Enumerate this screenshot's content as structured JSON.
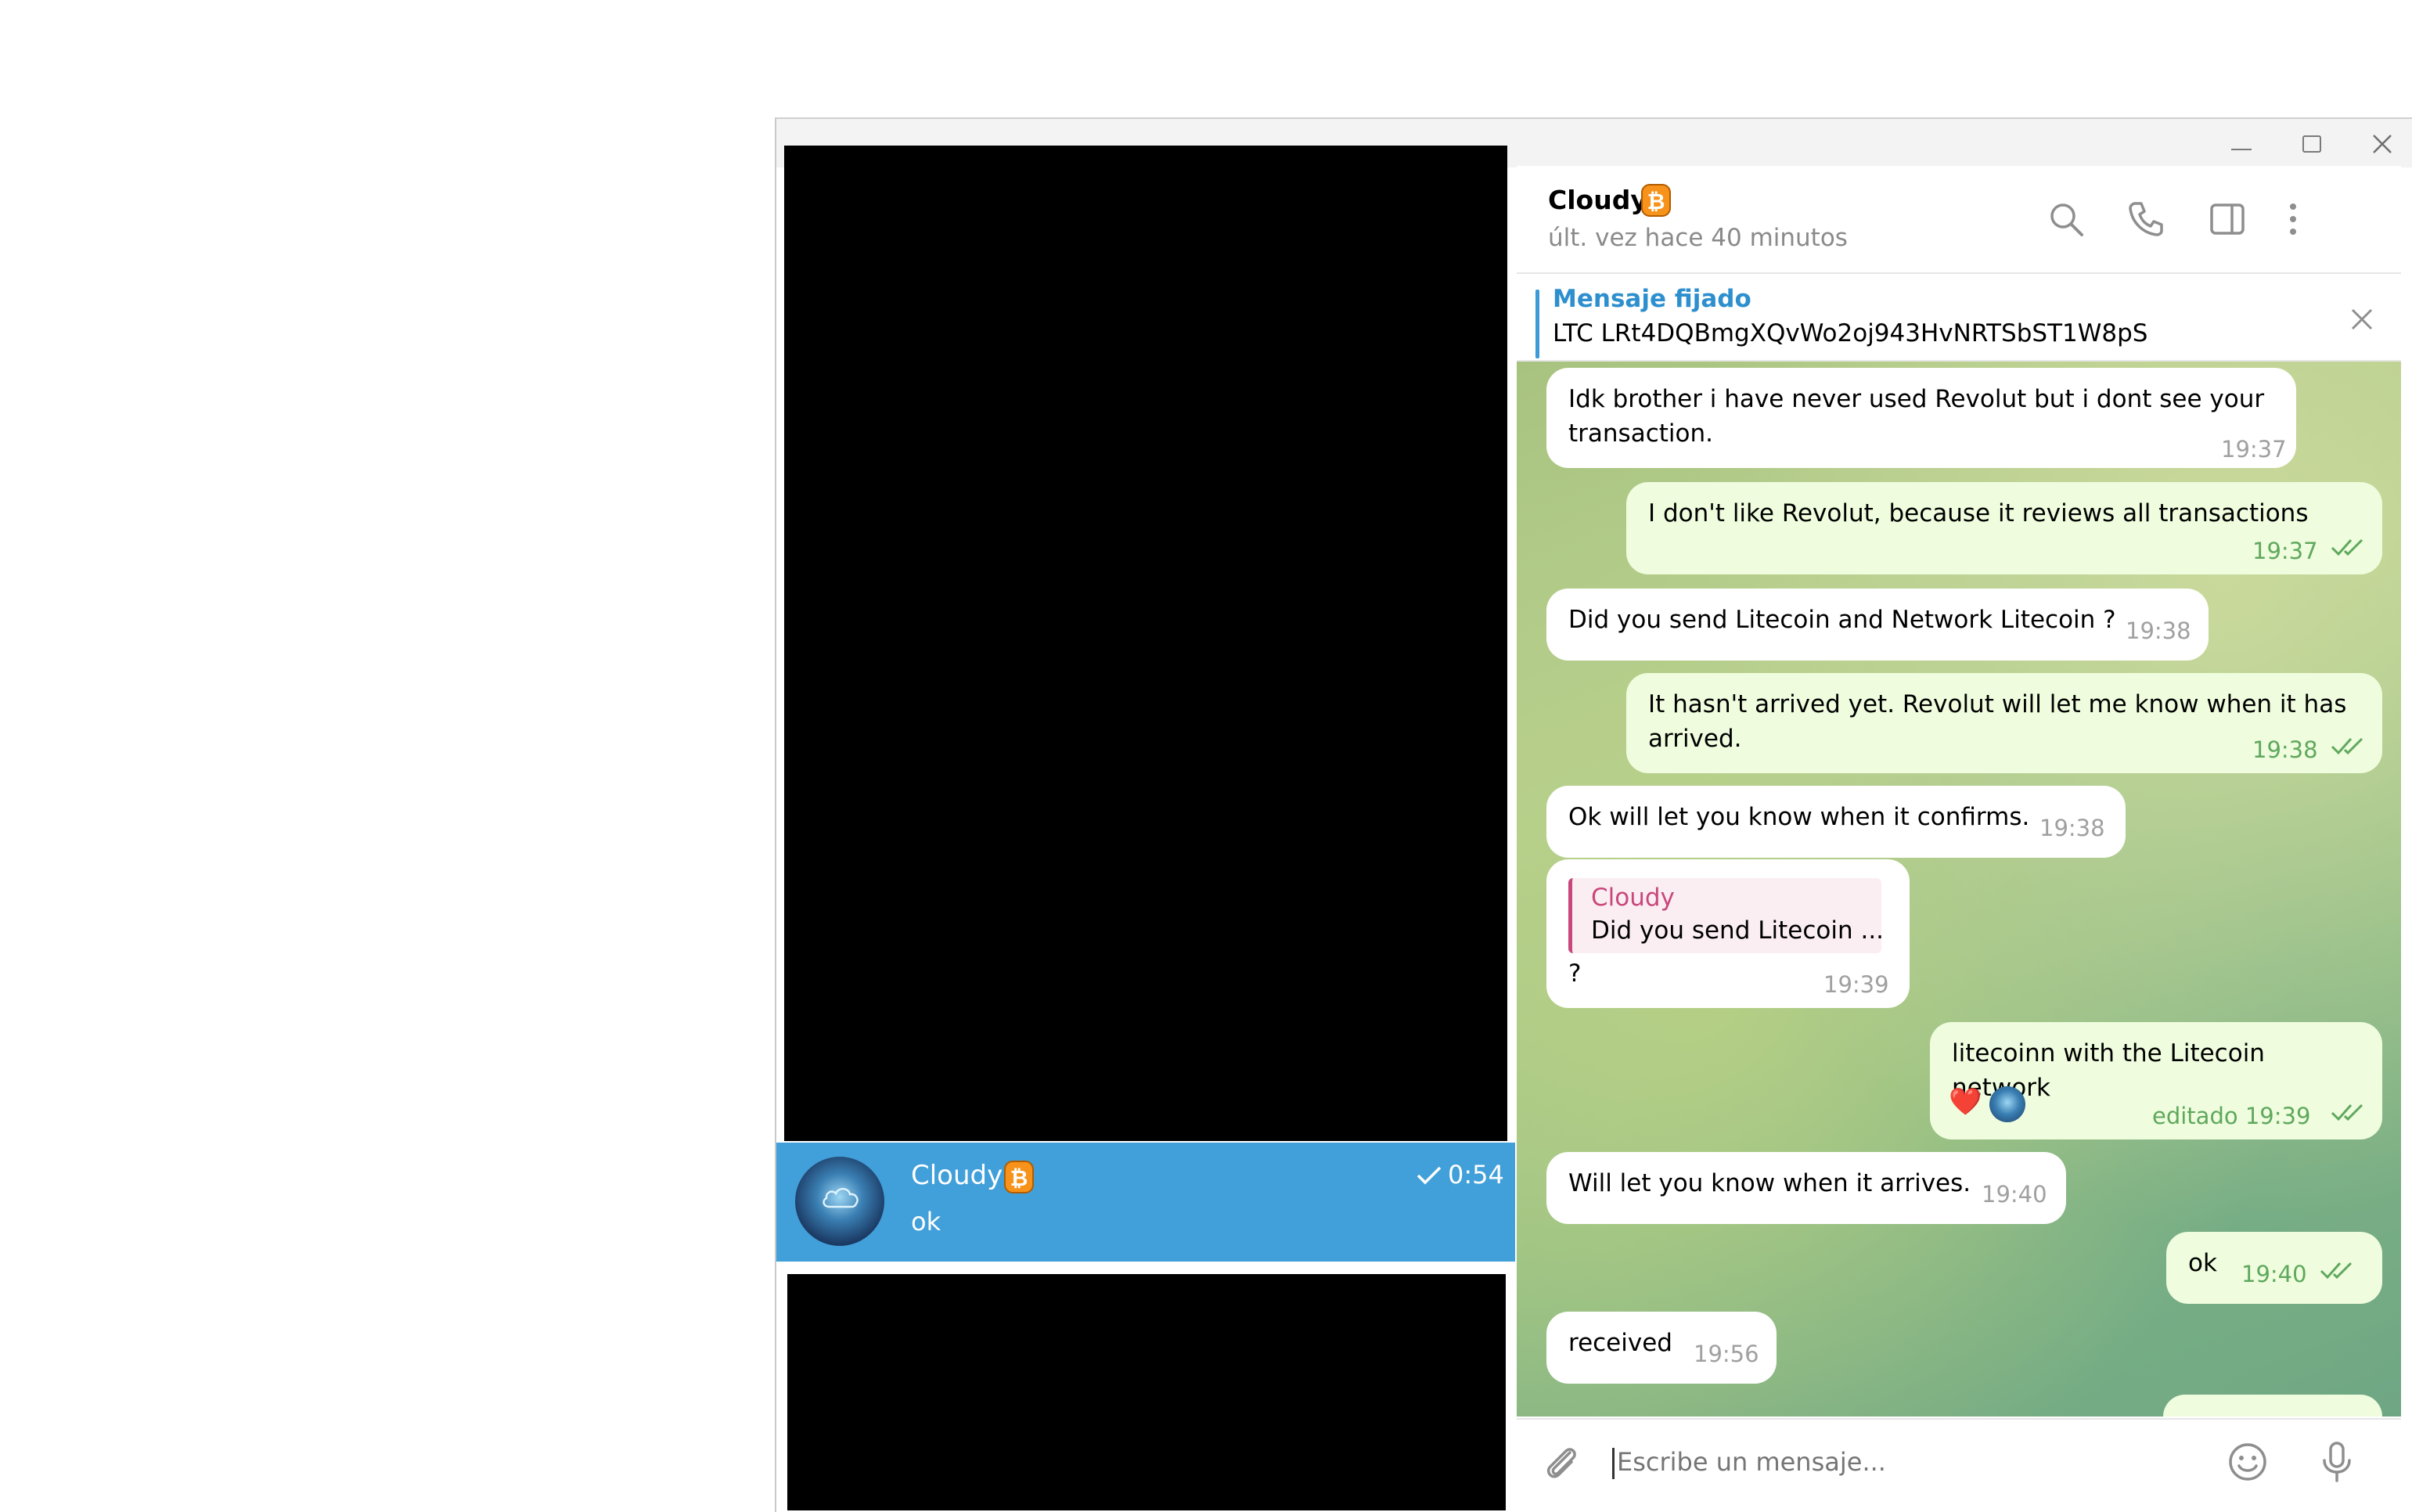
{
  "window": {
    "minimize": "minimize-icon",
    "maximize": "maximize-icon",
    "close": "close-icon"
  },
  "chat_list": {
    "selected": {
      "name": "Cloudy",
      "emoji": "bitcoin-icon",
      "time": "0:54",
      "last_message": "ok",
      "status": "sent-check"
    }
  },
  "chat": {
    "name": "Cloudy",
    "status": "últ. vez hace 40 minutos",
    "pinned": {
      "title": "Mensaje fijado",
      "text": "LTC LRt4DQBmgXQvWo2oj943HvNRTSbST1W8pS"
    },
    "messages": [
      {
        "dir": "in",
        "text": "Idk brother i have never used Revolut but i dont see your transaction.",
        "time": "19:37"
      },
      {
        "dir": "out",
        "text": "I don't like Revolut, because it reviews all transactions",
        "time": "19:37",
        "read": true
      },
      {
        "dir": "in",
        "text": "Did you send Litecoin and Network Litecoin ?",
        "time": "19:38"
      },
      {
        "dir": "out",
        "text": "It hasn't arrived yet. Revolut will let me know when it has arrived.",
        "time": "19:38",
        "read": true
      },
      {
        "dir": "in",
        "text": "Ok will let you know when it confirms.",
        "time": "19:38"
      },
      {
        "dir": "in",
        "reply_name": "Cloudy",
        "reply_text": "Did you send Litecoin ...",
        "text": "?",
        "time": "19:39"
      },
      {
        "dir": "out",
        "text": "litecoinn with the Litecoin network",
        "time": "editado 19:39",
        "read": true,
        "reactions": [
          "❤️"
        ]
      },
      {
        "dir": "in",
        "text": "Will let you know when it arrives.",
        "time": "19:40"
      },
      {
        "dir": "out",
        "text": "ok",
        "time": "19:40",
        "read": true
      },
      {
        "dir": "in",
        "text": "received",
        "time": "19:56"
      }
    ],
    "input_placeholder": "Escribe un mensaje..."
  },
  "colors": {
    "accent": "#419fd9",
    "outgoing": "#effdde",
    "incoming": "#ffffff",
    "check": "#5fa85d",
    "pinned_title": "#2d8fce",
    "reply_name": "#c9477b"
  }
}
